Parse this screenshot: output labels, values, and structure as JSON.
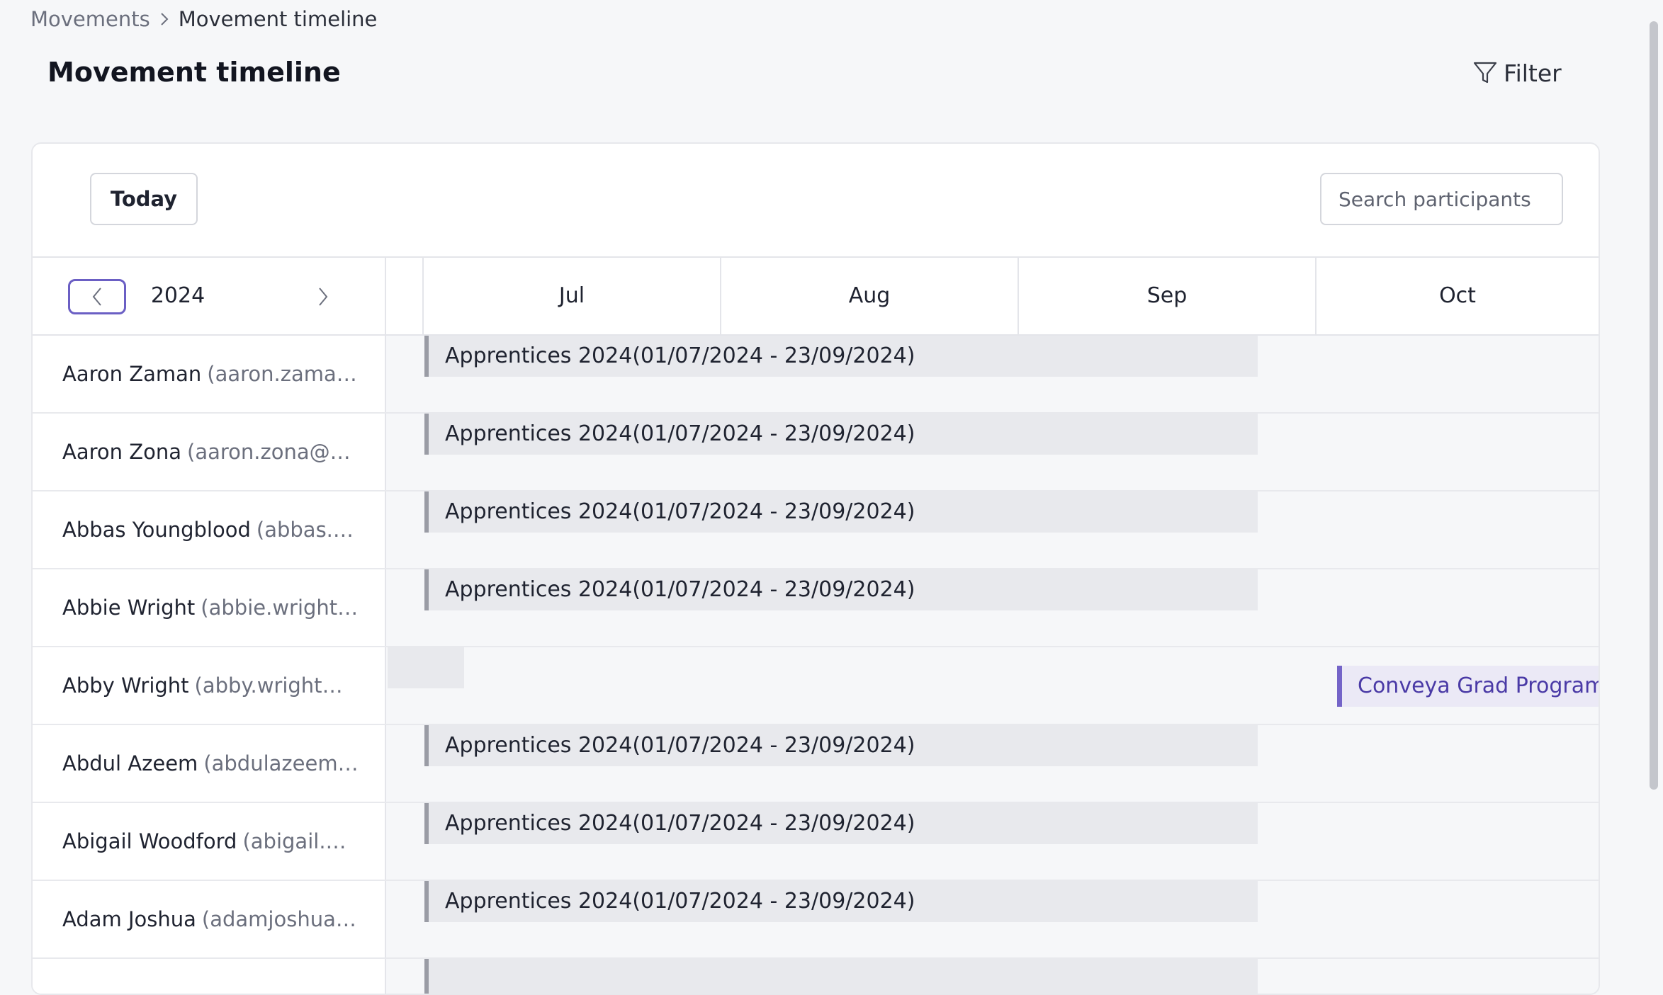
{
  "breadcrumb": {
    "parent": "Movements",
    "current": "Movement timeline"
  },
  "page": {
    "title": "Movement timeline",
    "filter_label": "Filter"
  },
  "toolbar": {
    "today_label": "Today",
    "search_placeholder": "Search participants"
  },
  "timeline": {
    "year": "2024",
    "months": [
      "Jul",
      "Aug",
      "Sep",
      "Oct"
    ],
    "rows": [
      {
        "name": "Aaron Zaman",
        "email": "(aaron.zaman…",
        "bar": "Apprentices 2024(01/07/2024 - 23/09/2024)"
      },
      {
        "name": "Aaron Zona",
        "email": "(aaron.zona@c…",
        "bar": "Apprentices 2024(01/07/2024 - 23/09/2024)"
      },
      {
        "name": "Abbas Youngblood",
        "email": "(abbas.…",
        "bar": "Apprentices 2024(01/07/2024 - 23/09/2024)"
      },
      {
        "name": "Abbie Wright",
        "email": "(abbie.wright…",
        "bar": "Apprentices 2024(01/07/2024 - 23/09/2024)"
      },
      {
        "name": "Abby Wright",
        "email": "(abby.wright@…",
        "secondary_bar": "Conveya Grad Programme"
      },
      {
        "name": "Abdul Azeem",
        "email": "(abdulazeem.…",
        "bar": "Apprentices 2024(01/07/2024 - 23/09/2024)"
      },
      {
        "name": "Abigail Woodford",
        "email": "(abigail.w…",
        "bar": "Apprentices 2024(01/07/2024 - 23/09/2024)"
      },
      {
        "name": "Adam Joshua",
        "email": "(adamjoshua…",
        "bar": "Apprentices 2024(01/07/2024 - 23/09/2024)"
      },
      {
        "name": "",
        "email": "",
        "bar": ""
      }
    ]
  },
  "colors": {
    "accent": "#6b5fc4",
    "bar_border": "#9a9ca5",
    "bar_fill": "#e8e9ed",
    "secondary_border": "#7464c8",
    "secondary_text": "#4a3aa6"
  }
}
